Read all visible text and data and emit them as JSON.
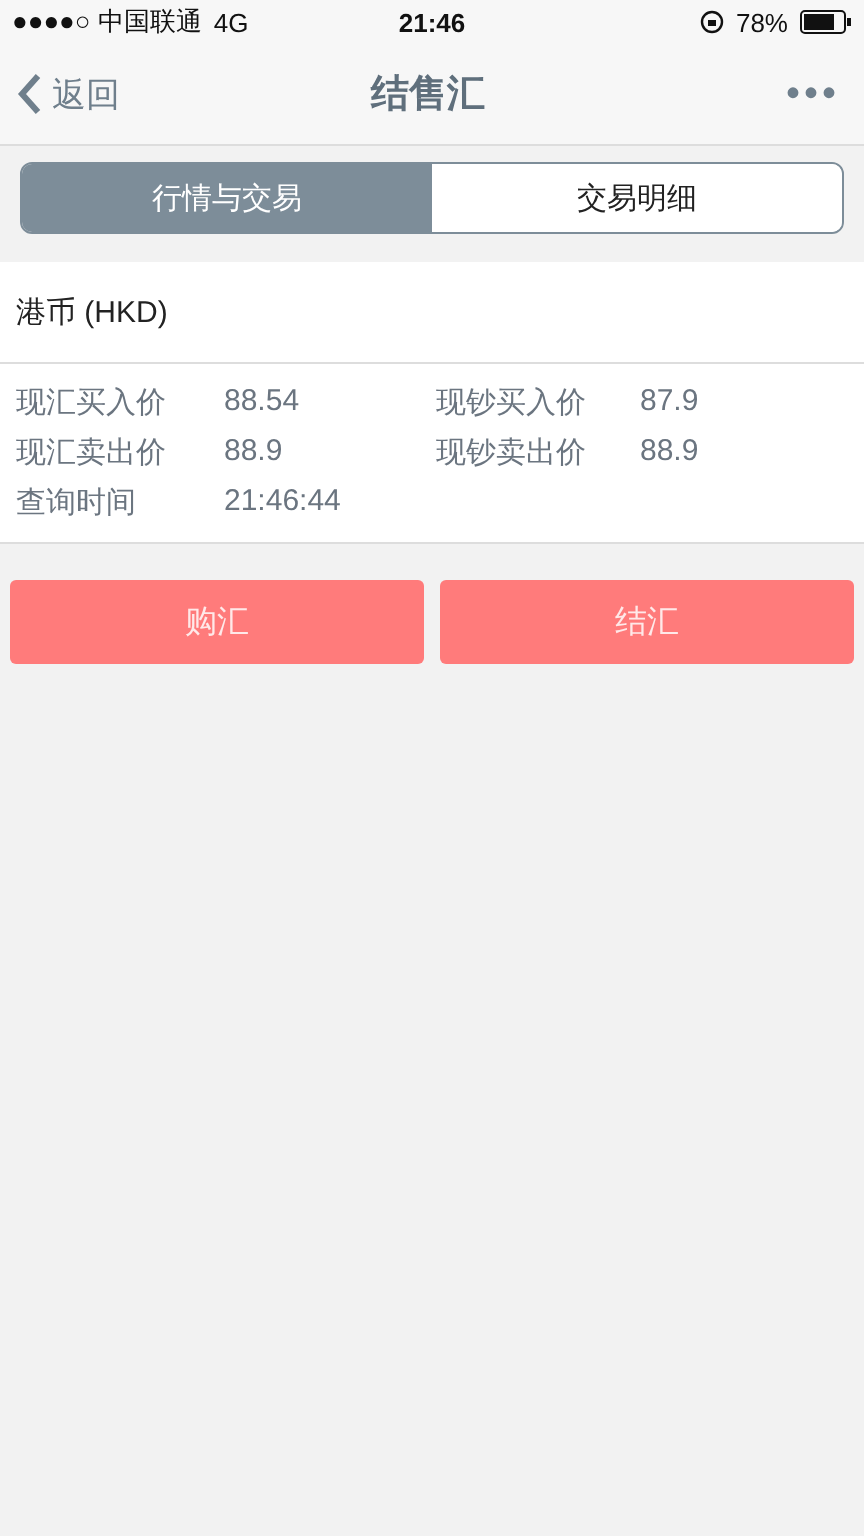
{
  "status_bar": {
    "carrier": "●●●●○ 中国联通",
    "network": "4G",
    "time": "21:46",
    "battery": "78%"
  },
  "nav": {
    "back": "返回",
    "title": "结售汇",
    "more": "•••"
  },
  "tabs": [
    {
      "label": "行情与交易",
      "selected": true
    },
    {
      "label": "交易明细",
      "selected": false
    }
  ],
  "currency": "港币 (HKD)",
  "rates": [
    {
      "label": "现汇买入价",
      "value": "88.54"
    },
    {
      "label": "现钞买入价",
      "value": "87.9"
    },
    {
      "label": "现汇卖出价",
      "value": "88.9"
    },
    {
      "label": "现钞卖出价",
      "value": "88.9"
    },
    {
      "label": "查询时间",
      "value": "21:46:44"
    }
  ],
  "buttons": [
    "购汇",
    "结汇"
  ]
}
